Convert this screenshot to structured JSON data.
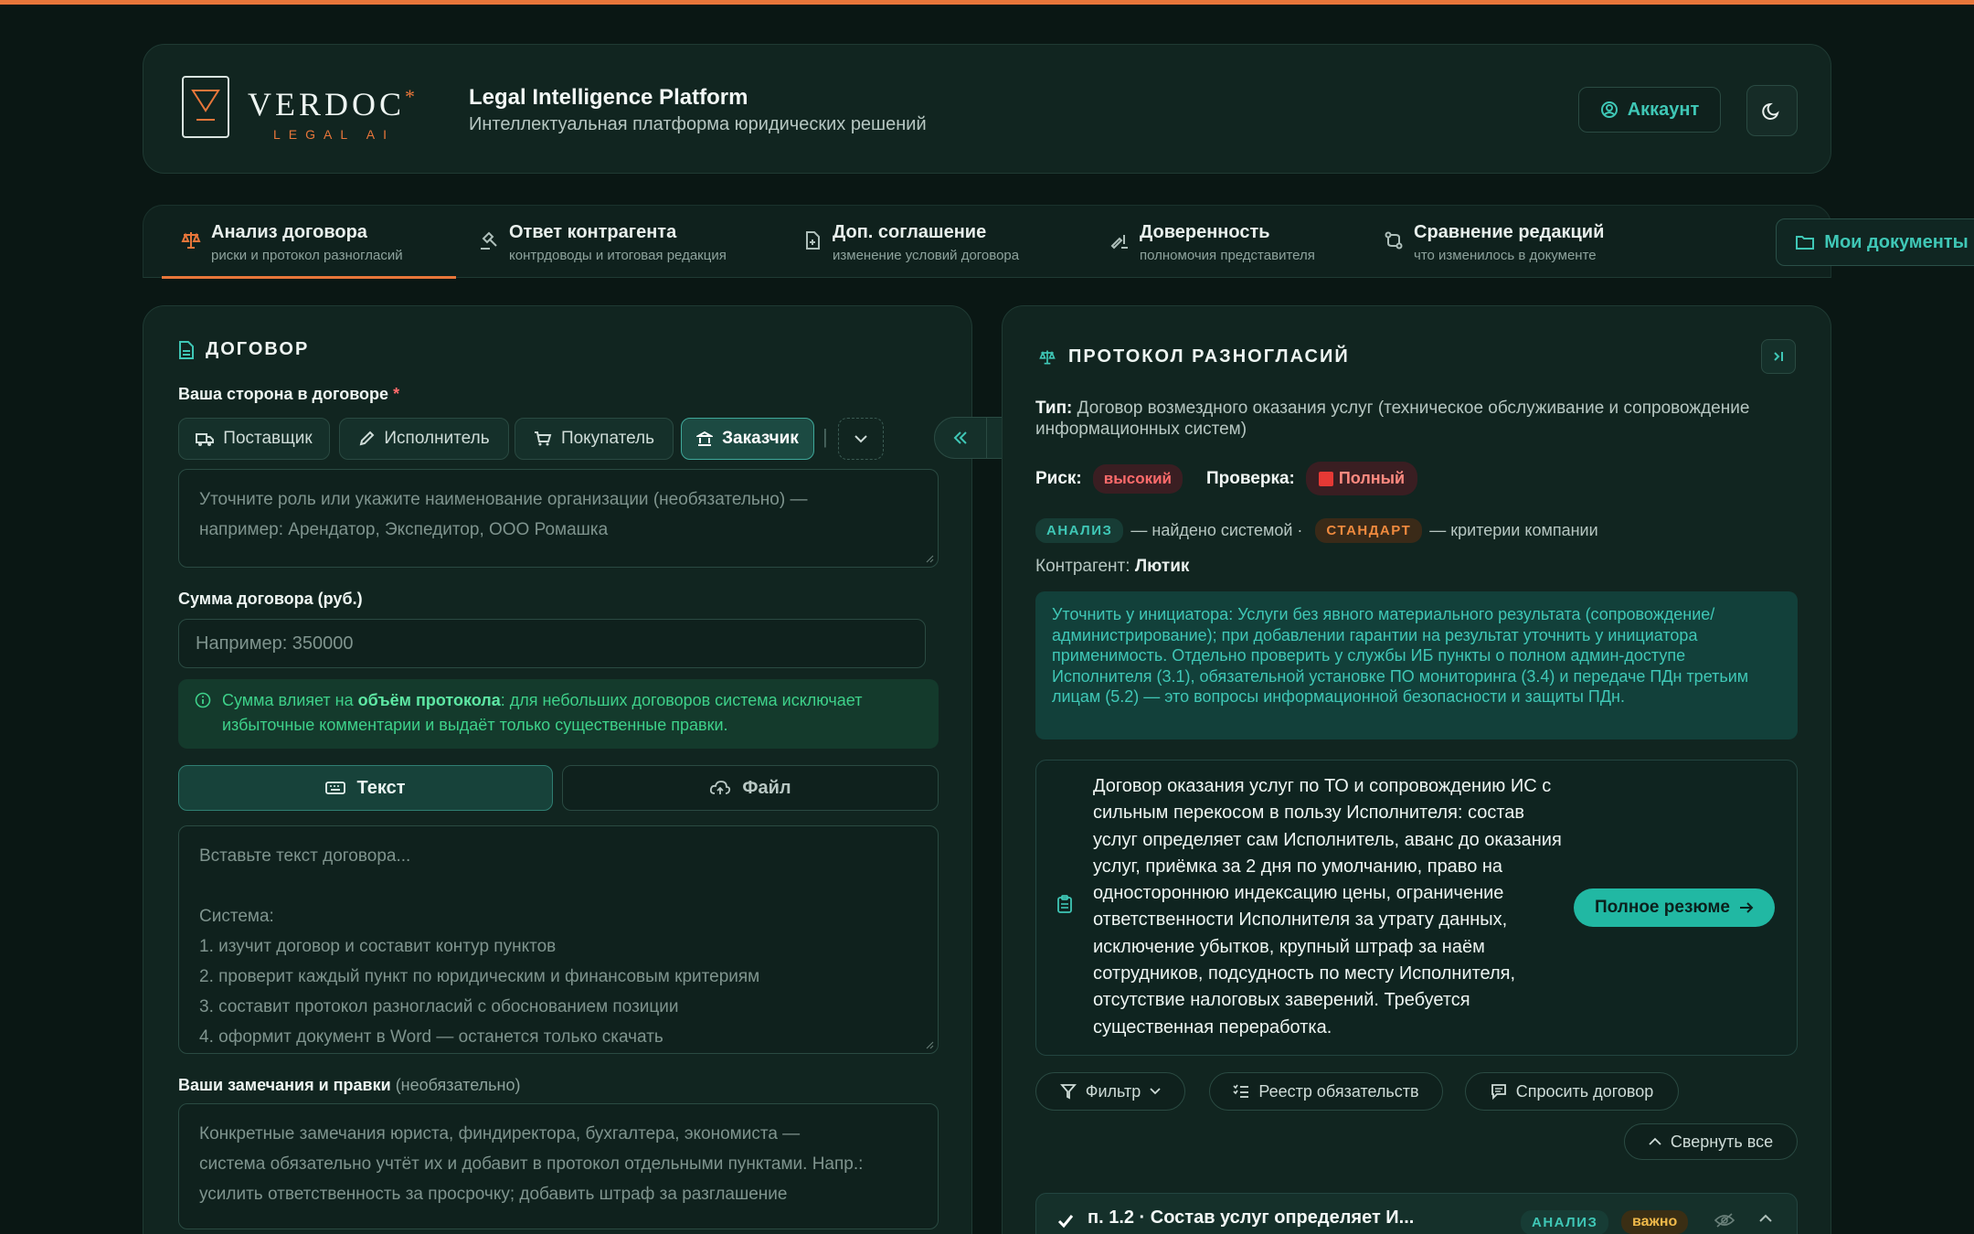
{
  "header": {
    "logo_word": "VERDOC",
    "logo_sub": "LEGAL AI",
    "title": "Legal Intelligence Platform",
    "subtitle": "Интеллектуальная платформа юридических решений",
    "account_label": "Аккаунт"
  },
  "tabs": [
    {
      "label": "Анализ договора",
      "sub": "риски и протокол разногласий"
    },
    {
      "label": "Ответ контрагента",
      "sub": "контрдоводы и итоговая редакция"
    },
    {
      "label": "Доп. соглашение",
      "sub": "изменение условий договора"
    },
    {
      "label": "Доверенность",
      "sub": "полномочия представителя"
    },
    {
      "label": "Сравнение редакций",
      "sub": "что изменилось в документе"
    }
  ],
  "my_docs_label": "Мои документы",
  "left": {
    "title": "ДОГОВОР",
    "side_label": "Ваша сторона в договоре",
    "required_mark": "*",
    "roles": [
      "Поставщик",
      "Исполнитель",
      "Покупатель",
      "Заказчик"
    ],
    "role_separator": "|",
    "role_placeholder_1": "Уточните роль или укажите наименование организации (необязательно) —",
    "role_placeholder_2": "например: Арендатор, Экспедитор, ООО Ромашка",
    "sum_label": "Сумма договора (руб.)",
    "sum_placeholder": "Например: 350000",
    "notice_pre": "Сумма влияет на ",
    "notice_bold": "объём протокола",
    "notice_post": ": для небольших договоров система исключает",
    "notice_line2": "избыточные комментарии и выдаёт только существенные правки.",
    "mode_text": "Текст",
    "mode_file": "Файл",
    "text_placeholder": [
      "Вставьте текст договора...",
      "",
      "Система:",
      "1. изучит договор и составит контур пунктов",
      "2. проверит каждый пункт по юридическим и финансовым критериям",
      "3. составит протокол разногласий с обоснованием позиции",
      "4. оформит документ в Word — останется только скачать"
    ],
    "remarks_label": "Ваши замечания и правки",
    "remarks_opt": "(необязательно)",
    "remarks_placeholder": [
      "Конкретные замечания юриста, финдиректора, бухгалтера, экономиста —",
      "система обязательно учтёт их и добавит в протокол отдельными пунктами. Напр.:",
      "усилить ответственность за просрочку; добавить штраф за разглашение"
    ]
  },
  "right": {
    "title": "ПРОТОКОЛ РАЗНОГЛАСИЙ",
    "type_label": "Тип:",
    "type_value": "Договор возмездного оказания услуг (техническое обслуживание и сопровождение информационных систем)",
    "risk_label": "Риск:",
    "risk_value": "высокий",
    "check_label": "Проверка:",
    "check_value": "Полный",
    "badge_analysis": "АНАЛИЗ",
    "analysis_desc": "— найдено системой ·",
    "badge_standard": "СТАНДАРТ",
    "standard_desc": "— критерии компании",
    "counterparty_label": "Контрагент:",
    "counterparty_value": "Лютик",
    "clarify_text": "Уточнить у инициатора: Услуги без явного материального результата (сопровождение/администрирование); при добавлении гарантии на результат уточнить у инициатора применимость. Отдельно проверить у службы ИБ пункты о полном админ-доступе Исполнителя (3.1), обязательной установке ПО мониторинга (3.4) и передаче ПДн третьим лицам (5.2) — это вопросы информационной безопасности и защиты ПДн.",
    "summary_text": "Договор оказания услуг по ТО и сопровождению ИС с сильным перекосом в пользу Исполнителя: состав услуг определяет сам Исполнитель, аванс до оказания услуг, приёмка за 2 дня по умолчанию, право на одностороннюю индексацию цены, ограничение ответственности Исполнителя за утрату данных, исключение убытков, крупный штраф за наём сотрудников, подсудность по месту Исполнителя, отсутствие налоговых заверений. Требуется существенная переработка.",
    "full_summary_label": "Полное резюме",
    "filter_label": "Фильтр",
    "registry_label": "Реестр обязательств",
    "ask_label": "Спросить договор",
    "collapse_all_label": "Свернуть все",
    "item_title": "п. 1.2 · Состав услуг определяет И...",
    "item_badge_important": "важно"
  }
}
